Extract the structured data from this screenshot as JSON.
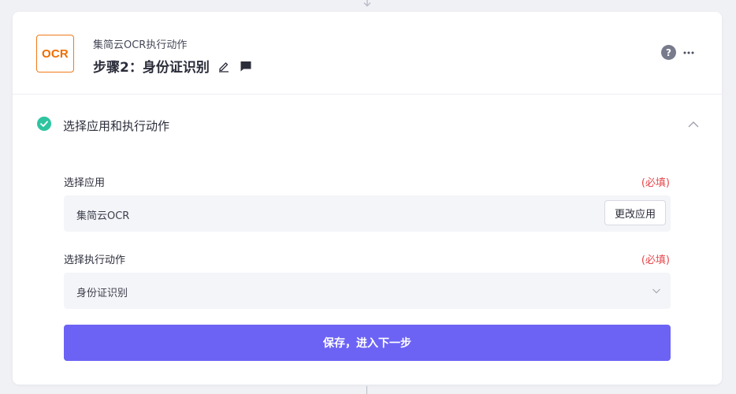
{
  "step": {
    "app_logo_text": "OCR",
    "app_name": "集简云OCR执行动作",
    "title": "步骤2：身份证识别",
    "help_symbol": "?"
  },
  "section": {
    "title": "选择应用和执行动作"
  },
  "fields": {
    "app": {
      "label": "选择应用",
      "required": "(必填)",
      "value": "集简云OCR",
      "change_button": "更改应用"
    },
    "action": {
      "label": "选择执行动作",
      "required": "(必填)",
      "value": "身份证识别"
    }
  },
  "save_button": "保存，进入下一步",
  "colors": {
    "accent": "#6c63f5",
    "success": "#2ec4a0",
    "required": "#e5484d",
    "logo": "#ef6c00"
  },
  "icons": [
    "edit-icon",
    "comment-icon",
    "help-icon",
    "more-icon",
    "check-circle-icon",
    "chevron-up-icon",
    "chevron-down-icon",
    "arrow-down-icon"
  ]
}
